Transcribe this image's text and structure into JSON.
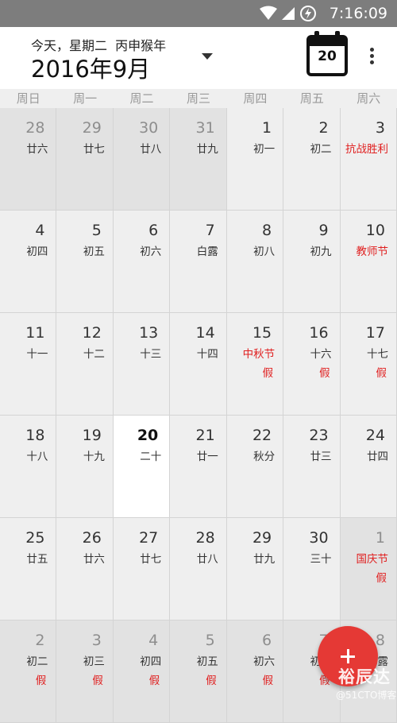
{
  "status_bar": {
    "time": "7:16:09"
  },
  "header": {
    "subtitle": "今天，星期二  丙申猴年",
    "month_title": "2016年9月",
    "today_day": "20"
  },
  "weekdays": [
    "周日",
    "周一",
    "周二",
    "周三",
    "周四",
    "周五",
    "周六"
  ],
  "weeks": [
    [
      {
        "day": "28",
        "lunar": "廿六",
        "other": true
      },
      {
        "day": "29",
        "lunar": "廿七",
        "other": true
      },
      {
        "day": "30",
        "lunar": "廿八",
        "other": true
      },
      {
        "day": "31",
        "lunar": "廿九",
        "other": true
      },
      {
        "day": "1",
        "lunar": "初一"
      },
      {
        "day": "2",
        "lunar": "初二"
      },
      {
        "day": "3",
        "lunar": "抗战胜利",
        "red": true
      }
    ],
    [
      {
        "day": "4",
        "lunar": "初四"
      },
      {
        "day": "5",
        "lunar": "初五"
      },
      {
        "day": "6",
        "lunar": "初六"
      },
      {
        "day": "7",
        "lunar": "白露"
      },
      {
        "day": "8",
        "lunar": "初八"
      },
      {
        "day": "9",
        "lunar": "初九"
      },
      {
        "day": "10",
        "lunar": "教师节",
        "red": true
      }
    ],
    [
      {
        "day": "11",
        "lunar": "十一"
      },
      {
        "day": "12",
        "lunar": "十二"
      },
      {
        "day": "13",
        "lunar": "十三"
      },
      {
        "day": "14",
        "lunar": "十四"
      },
      {
        "day": "15",
        "lunar": "中秋节",
        "red": true,
        "holiday": "假"
      },
      {
        "day": "16",
        "lunar": "十六",
        "holiday": "假"
      },
      {
        "day": "17",
        "lunar": "十七",
        "holiday": "假"
      }
    ],
    [
      {
        "day": "18",
        "lunar": "十八"
      },
      {
        "day": "19",
        "lunar": "十九"
      },
      {
        "day": "20",
        "lunar": "二十",
        "today": true
      },
      {
        "day": "21",
        "lunar": "廿一"
      },
      {
        "day": "22",
        "lunar": "秋分"
      },
      {
        "day": "23",
        "lunar": "廿三"
      },
      {
        "day": "24",
        "lunar": "廿四"
      }
    ],
    [
      {
        "day": "25",
        "lunar": "廿五"
      },
      {
        "day": "26",
        "lunar": "廿六"
      },
      {
        "day": "27",
        "lunar": "廿七"
      },
      {
        "day": "28",
        "lunar": "廿八"
      },
      {
        "day": "29",
        "lunar": "廿九"
      },
      {
        "day": "30",
        "lunar": "三十"
      },
      {
        "day": "1",
        "lunar": "国庆节",
        "red": true,
        "holiday": "假",
        "other": true
      }
    ],
    [
      {
        "day": "2",
        "lunar": "初二",
        "holiday": "假",
        "other": true
      },
      {
        "day": "3",
        "lunar": "初三",
        "holiday": "假",
        "other": true
      },
      {
        "day": "4",
        "lunar": "初四",
        "holiday": "假",
        "other": true
      },
      {
        "day": "5",
        "lunar": "初五",
        "holiday": "假",
        "other": true
      },
      {
        "day": "6",
        "lunar": "初六",
        "holiday": "假",
        "other": true
      },
      {
        "day": "7",
        "lunar": "初七",
        "holiday": "假",
        "other": true
      },
      {
        "day": "8",
        "lunar": "寒露",
        "other": true
      }
    ]
  ],
  "watermark": {
    "brand": "裕辰达",
    "site": "@51CTO博客"
  },
  "colors": {
    "accent_red": "#e53935",
    "holiday_red": "#e02020"
  },
  "icons": [
    "wifi-icon",
    "signal-icon",
    "battery-icon",
    "calendar-today-icon",
    "more-vert-icon",
    "dropdown-arrow-icon",
    "add-icon"
  ]
}
